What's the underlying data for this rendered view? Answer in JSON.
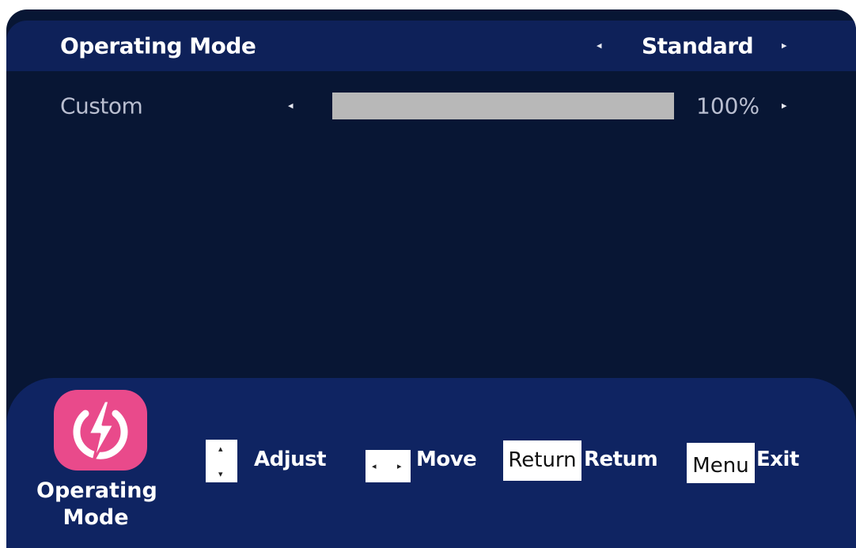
{
  "osd": {
    "rows": [
      {
        "label": "Operating Mode",
        "value": "Standard",
        "left_arrow": "◂",
        "right_arrow": "▸"
      },
      {
        "label": "Custom",
        "percent_text": "100%",
        "level": 1.0,
        "left_arrow": "◂",
        "right_arrow": "▸"
      }
    ]
  },
  "footer": {
    "title": "Operating Mode",
    "icon": "power-lightning-icon",
    "hints": {
      "adjust_up": "▴",
      "adjust_down": "▾",
      "adjust_label": "Adjust",
      "move_left": "◂",
      "move_right": "▸",
      "move_label": "Move",
      "return_key": "Return",
      "return_label": "Retum",
      "menu_key": "Menu",
      "menu_label": "Exit"
    }
  },
  "colors": {
    "background": "#081634",
    "highlight_row": "#0e2159",
    "footer": "#0f2462",
    "icon_bg": "#e94a8b",
    "bar_fill": "#b8b8b8"
  }
}
